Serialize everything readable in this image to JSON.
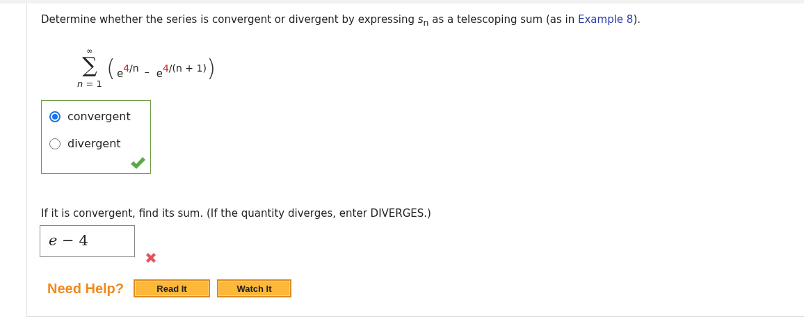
{
  "question": {
    "prompt_before": "Determine whether the series is convergent or divergent by expressing *s*$_{n}$ as a telescoping sum (as in ",
    "link": "Example 8",
    "prompt_after": ")."
  },
  "formula": {
    "sigma": "∑",
    "upper": "∞",
    "lower": "n = 1",
    "open": "(",
    "base_1": "e",
    "exp_1_number": "4",
    "exp_1_rest": "/n",
    "minus": "–",
    "base_2": "e",
    "exp_2_number": "4",
    "exp_2_rest": "/(n + 1)",
    "close": ")"
  },
  "choices": {
    "correct": true,
    "options": [
      {
        "label": "convergent",
        "selected": true
      },
      {
        "label": "divergent",
        "selected": false
      }
    ]
  },
  "sum_part": {
    "prompt": "If it is convergent, find its sum. (If the quantity diverges, enter DIVERGES.)",
    "answer": "*e* − 4",
    "correct": false
  },
  "help": {
    "label": "Need Help?",
    "buttons": [
      "Read It",
      "Watch It"
    ]
  }
}
